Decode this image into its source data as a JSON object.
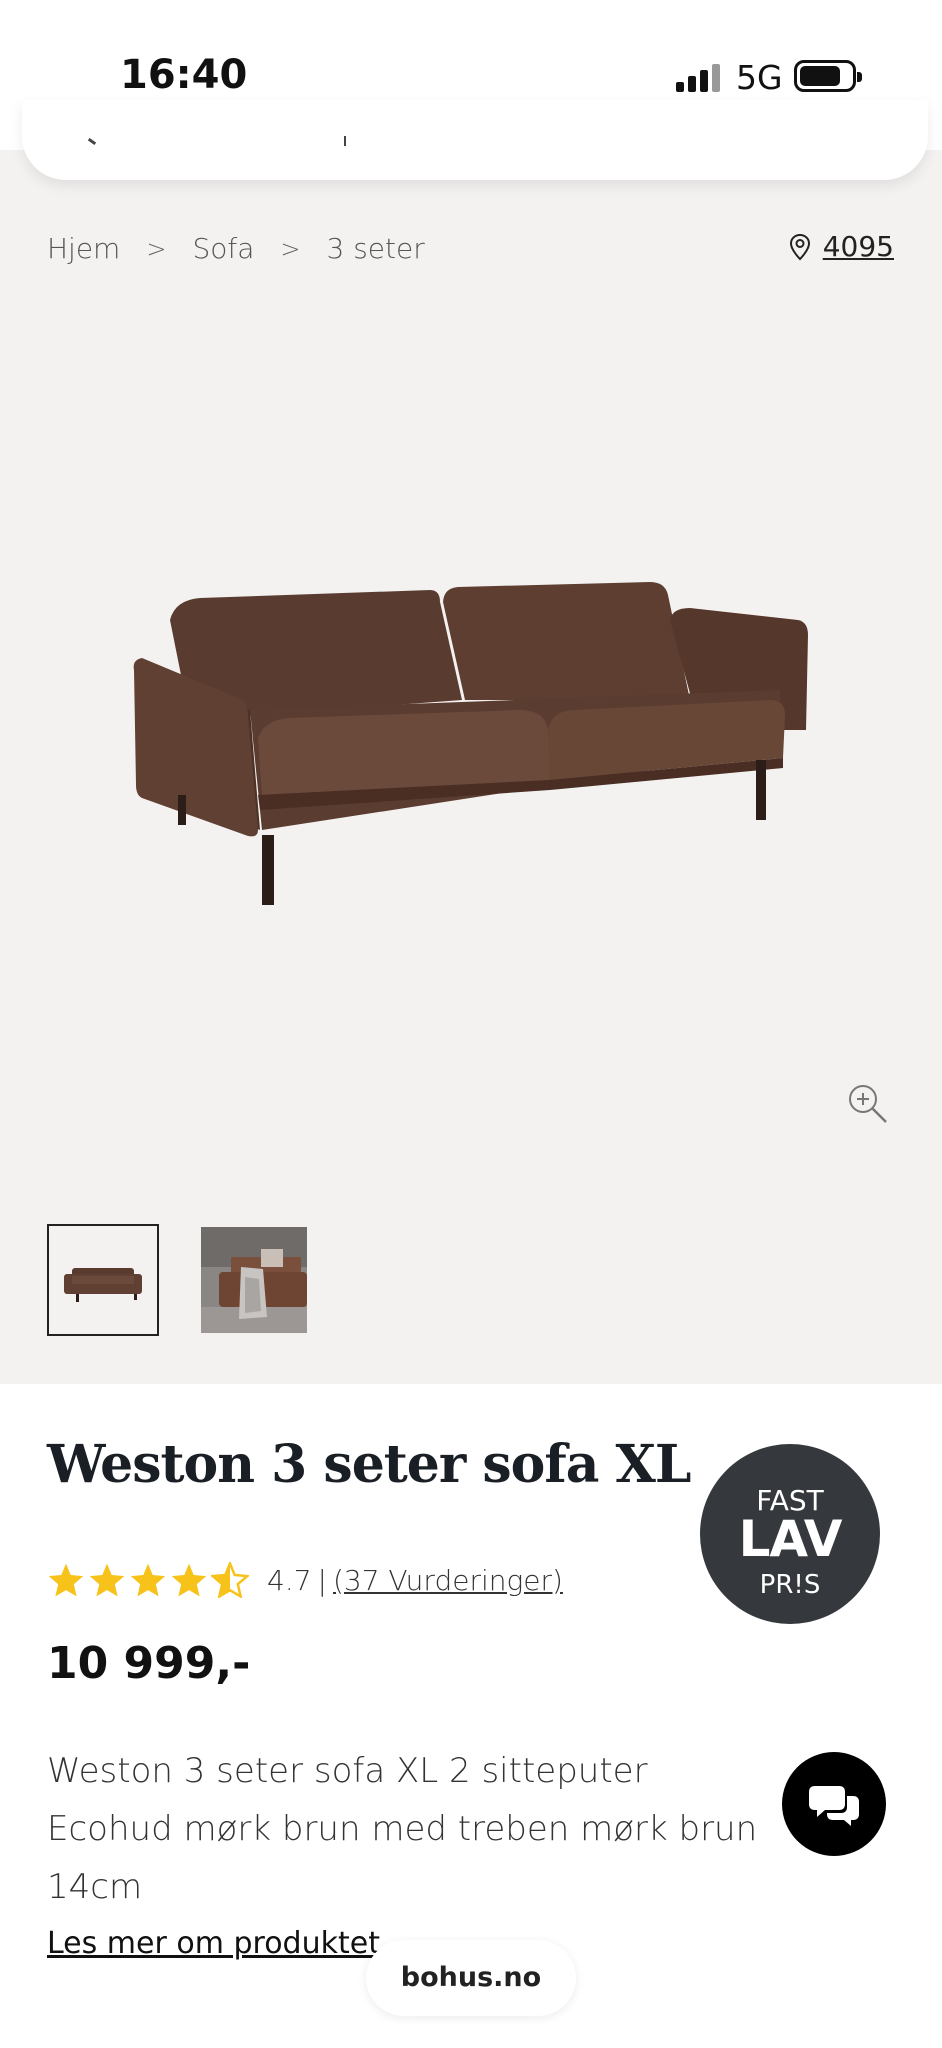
{
  "status_bar": {
    "time": "16:40",
    "network": "5G"
  },
  "breadcrumb": {
    "items": [
      "Hjem",
      "Sofa",
      "3 seter"
    ],
    "separator": ">"
  },
  "location": {
    "icon": "location-pin-icon",
    "postcode": "4095"
  },
  "gallery": {
    "zoom_icon": "zoom-in-icon",
    "thumbnails": [
      "sofa-product-photo",
      "sofa-room-photo"
    ]
  },
  "product": {
    "title": "Weston 3 seter sofa XL",
    "rating": {
      "stars": 4.5,
      "value": "4.7",
      "separator": "|",
      "reviews": "(37 Vurderinger)"
    },
    "price": "10 999,-",
    "description": "Weston 3 seter sofa XL 2 sitteputer Ecohud mørk brun med treben mørk brun 14cm",
    "read_more": "Les mer om produktet"
  },
  "badge": {
    "line1": "FAST",
    "line2": "LAV",
    "line3": "PR!S"
  },
  "chat": {
    "icon": "chat-bubbles-icon"
  },
  "browser": {
    "url": "bohus.no"
  },
  "colors": {
    "star": "#f7c21a",
    "badge_bg": "#35383c",
    "page_bg": "#f4f2f1",
    "sofa": "#5d3d31"
  }
}
